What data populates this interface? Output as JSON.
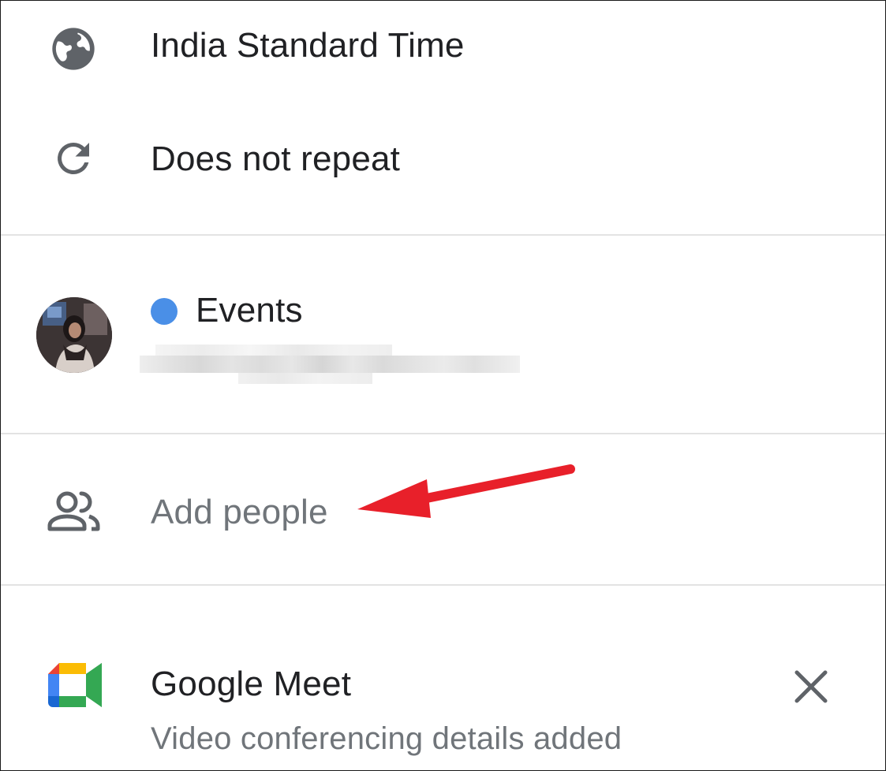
{
  "timezone": {
    "icon": "globe-icon",
    "label": "India Standard Time"
  },
  "repeat": {
    "icon": "repeat-icon",
    "label": "Does not repeat"
  },
  "calendar": {
    "icon": "avatar",
    "dot_color": "#4285f4",
    "name": "Events"
  },
  "people": {
    "icon": "people-icon",
    "placeholder": "Add people"
  },
  "conference": {
    "icon": "google-meet-icon",
    "title": "Google Meet",
    "subtitle": "Video conferencing details added",
    "close_icon": "close-icon"
  },
  "annotation": {
    "arrow_color": "#e8202a"
  }
}
